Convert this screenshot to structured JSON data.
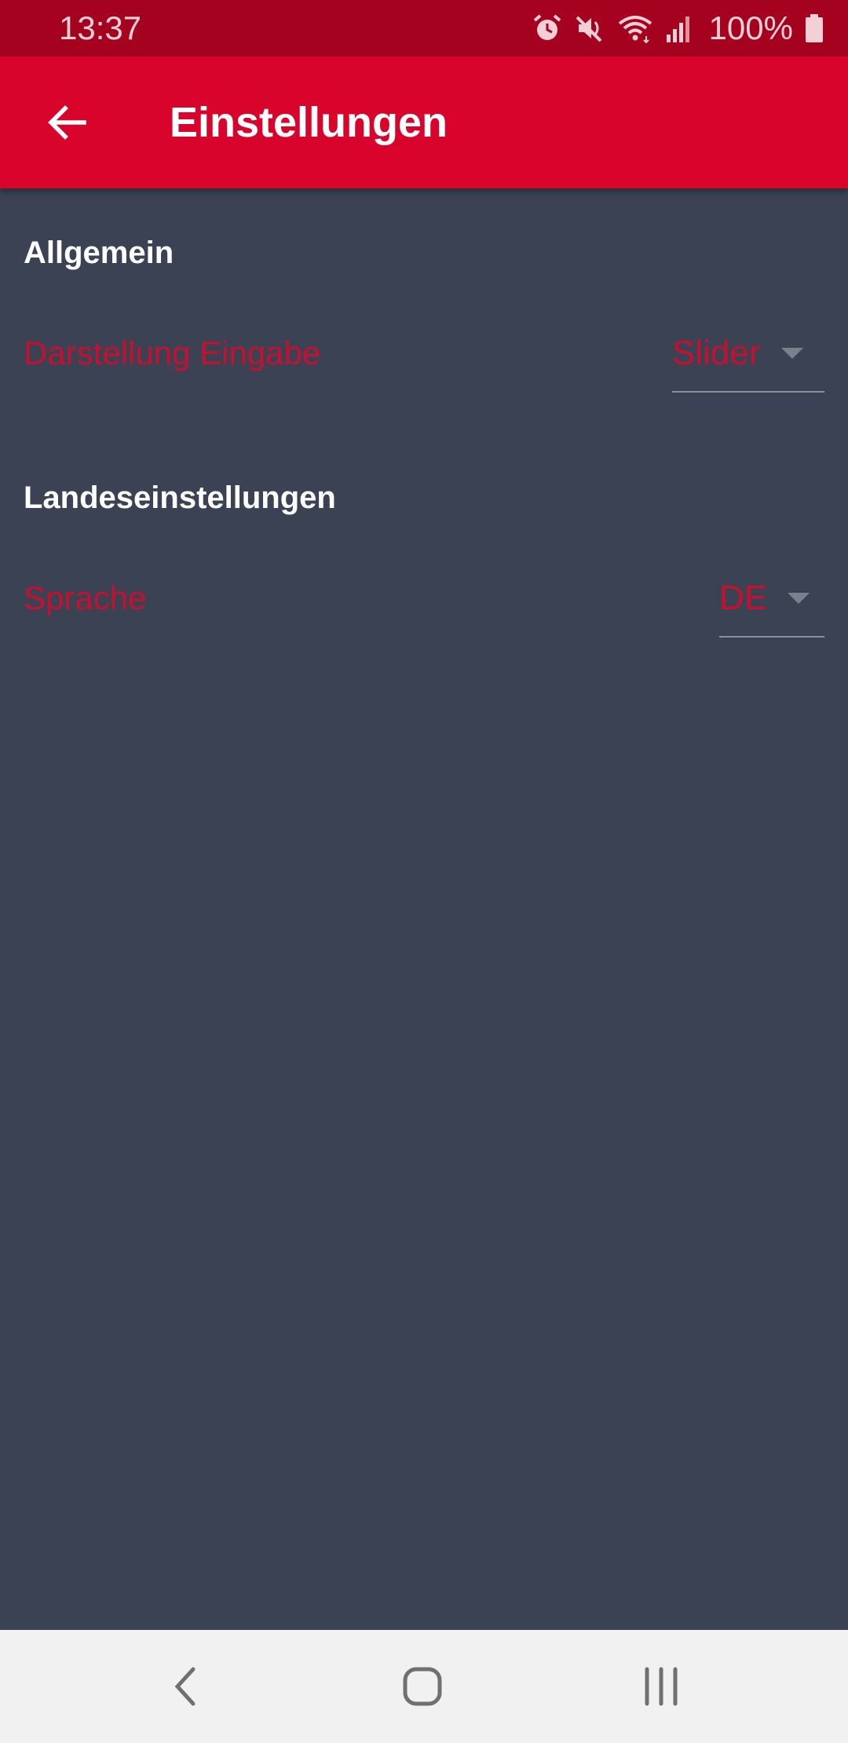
{
  "status_bar": {
    "time": "13:37",
    "battery_percent": "100%",
    "icons": [
      "alarm-icon",
      "mute-icon",
      "wifi-icon",
      "signal-icon",
      "battery-icon"
    ]
  },
  "app_bar": {
    "title": "Einstellungen",
    "back_icon": "arrow-back-icon"
  },
  "sections": {
    "general": {
      "header": "Allgemein",
      "setting_label": "Darstellung Eingabe",
      "setting_value": "Slider"
    },
    "locale": {
      "header": "Landeseinstellungen",
      "setting_label": "Sprache",
      "setting_value": "DE"
    }
  },
  "nav_bar": {
    "icons": [
      "back-icon",
      "home-icon",
      "recent-apps-icon"
    ]
  },
  "colors": {
    "status_bar": "#a50220",
    "app_bar": "#d9042b",
    "background": "#3a4254",
    "accent": "#c8102e"
  }
}
